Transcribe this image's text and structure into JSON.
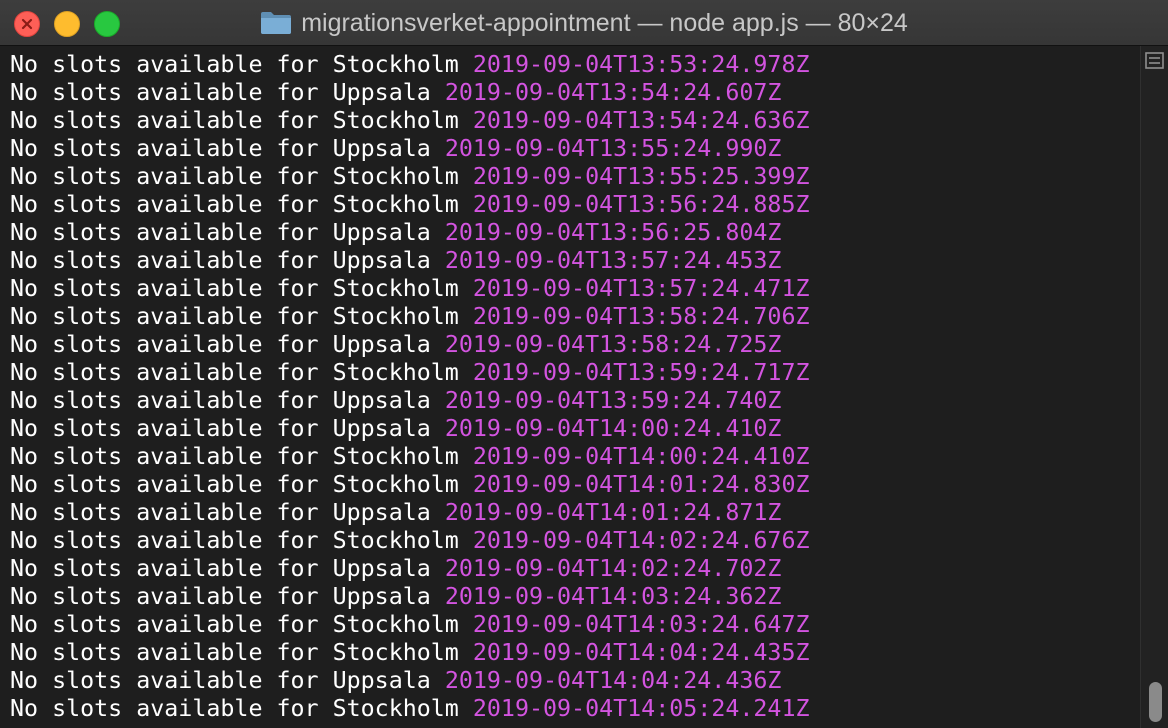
{
  "window": {
    "title": "migrationsverket-appointment — node app.js — 80×24"
  },
  "colors": {
    "message": "#ffffff",
    "timestamp": "#d354e0",
    "background": "#1e1e1e"
  },
  "scroll_position": 1.0,
  "lines": [
    {
      "msg": "No slots available for Stockholm",
      "ts": "2019-09-04T13:53:24.978Z"
    },
    {
      "msg": "No slots available for Uppsala",
      "ts": "2019-09-04T13:54:24.607Z"
    },
    {
      "msg": "No slots available for Stockholm",
      "ts": "2019-09-04T13:54:24.636Z"
    },
    {
      "msg": "No slots available for Uppsala",
      "ts": "2019-09-04T13:55:24.990Z"
    },
    {
      "msg": "No slots available for Stockholm",
      "ts": "2019-09-04T13:55:25.399Z"
    },
    {
      "msg": "No slots available for Stockholm",
      "ts": "2019-09-04T13:56:24.885Z"
    },
    {
      "msg": "No slots available for Uppsala",
      "ts": "2019-09-04T13:56:25.804Z"
    },
    {
      "msg": "No slots available for Uppsala",
      "ts": "2019-09-04T13:57:24.453Z"
    },
    {
      "msg": "No slots available for Stockholm",
      "ts": "2019-09-04T13:57:24.471Z"
    },
    {
      "msg": "No slots available for Stockholm",
      "ts": "2019-09-04T13:58:24.706Z"
    },
    {
      "msg": "No slots available for Uppsala",
      "ts": "2019-09-04T13:58:24.725Z"
    },
    {
      "msg": "No slots available for Stockholm",
      "ts": "2019-09-04T13:59:24.717Z"
    },
    {
      "msg": "No slots available for Uppsala",
      "ts": "2019-09-04T13:59:24.740Z"
    },
    {
      "msg": "No slots available for Uppsala",
      "ts": "2019-09-04T14:00:24.410Z"
    },
    {
      "msg": "No slots available for Stockholm",
      "ts": "2019-09-04T14:00:24.410Z"
    },
    {
      "msg": "No slots available for Stockholm",
      "ts": "2019-09-04T14:01:24.830Z"
    },
    {
      "msg": "No slots available for Uppsala",
      "ts": "2019-09-04T14:01:24.871Z"
    },
    {
      "msg": "No slots available for Stockholm",
      "ts": "2019-09-04T14:02:24.676Z"
    },
    {
      "msg": "No slots available for Uppsala",
      "ts": "2019-09-04T14:02:24.702Z"
    },
    {
      "msg": "No slots available for Uppsala",
      "ts": "2019-09-04T14:03:24.362Z"
    },
    {
      "msg": "No slots available for Stockholm",
      "ts": "2019-09-04T14:03:24.647Z"
    },
    {
      "msg": "No slots available for Stockholm",
      "ts": "2019-09-04T14:04:24.435Z"
    },
    {
      "msg": "No slots available for Uppsala",
      "ts": "2019-09-04T14:04:24.436Z"
    },
    {
      "msg": "No slots available for Stockholm",
      "ts": "2019-09-04T14:05:24.241Z"
    }
  ]
}
